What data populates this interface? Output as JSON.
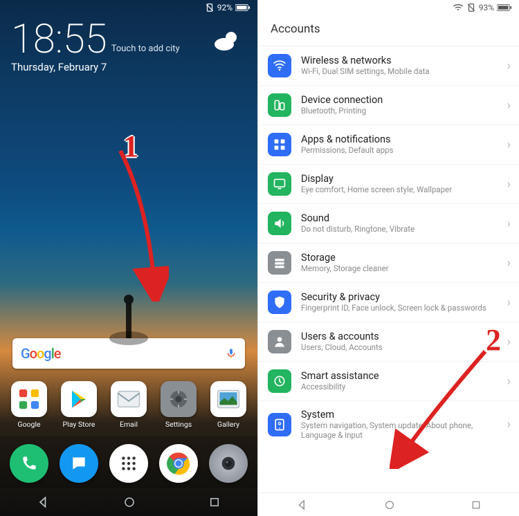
{
  "home": {
    "status": {
      "battery_text": "92%"
    },
    "clock": "18:55",
    "add_city": "Touch to add city",
    "date": "Thursday, February 7",
    "search_brand": "Google",
    "apps": [
      {
        "label": "Google",
        "bg": "#ffffff"
      },
      {
        "label": "Play Store",
        "bg": "#ffffff"
      },
      {
        "label": "Email",
        "bg": "#ffffff"
      },
      {
        "label": "Settings",
        "bg": "#8a8f94"
      },
      {
        "label": "Gallery",
        "bg": "#ffffff"
      }
    ],
    "annotation_num": "1"
  },
  "settings": {
    "status": {
      "battery_text": "93%"
    },
    "section_title": "Accounts",
    "items": [
      {
        "icon": "wifi",
        "color": "#2f6df6",
        "title": "Wireless & networks",
        "sub": "Wi-Fi, Dual SIM settings, Mobile data"
      },
      {
        "icon": "link",
        "color": "#22b45e",
        "title": "Device connection",
        "sub": "Bluetooth, Printing"
      },
      {
        "icon": "apps",
        "color": "#2f6df6",
        "title": "Apps & notifications",
        "sub": "Permissions, Default apps"
      },
      {
        "icon": "display",
        "color": "#22b45e",
        "title": "Display",
        "sub": "Eye comfort, Home screen style, Wallpaper"
      },
      {
        "icon": "sound",
        "color": "#22b45e",
        "title": "Sound",
        "sub": "Do not disturb, Ringtone, Vibrate"
      },
      {
        "icon": "storage",
        "color": "#8a8f94",
        "title": "Storage",
        "sub": "Memory, Storage cleaner"
      },
      {
        "icon": "shield",
        "color": "#2f6df6",
        "title": "Security & privacy",
        "sub": "Fingerprint ID, Face unlock, Screen lock & passwords"
      },
      {
        "icon": "user",
        "color": "#8a8f94",
        "title": "Users & accounts",
        "sub": "Users, Cloud, Accounts"
      },
      {
        "icon": "smart",
        "color": "#22b45e",
        "title": "Smart assistance",
        "sub": "Accessibility"
      },
      {
        "icon": "system",
        "color": "#2f6df6",
        "title": "System",
        "sub": "System navigation, System update, About phone, Language & input"
      }
    ],
    "annotation_num": "2"
  }
}
